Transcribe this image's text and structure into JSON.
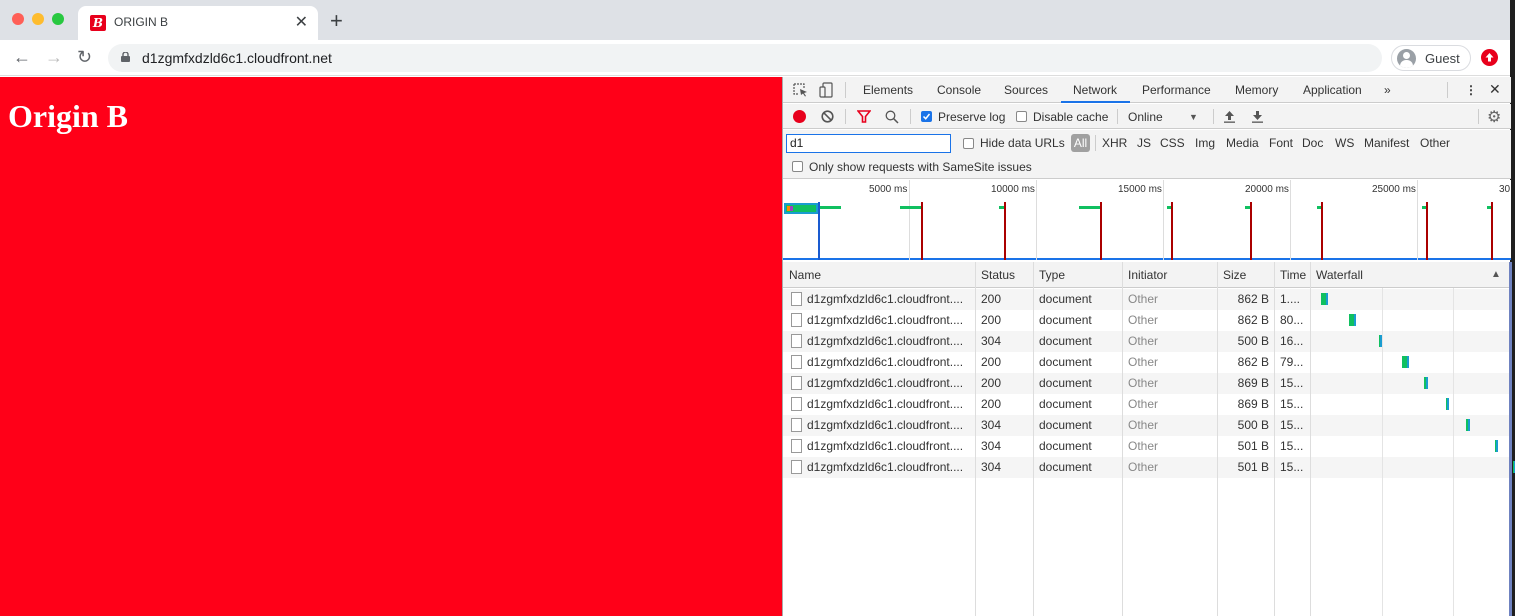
{
  "browser": {
    "tab": {
      "title": "ORIGIN B",
      "favicon_letter": "B"
    },
    "new_tab_label": "+",
    "url": "d1zgmfxdzld6c1.cloudfront.net",
    "profile_label": "Guest",
    "colors": {
      "brand_red": "#e8001c",
      "page_bg": "#ff0018"
    }
  },
  "page": {
    "heading": "Origin B"
  },
  "devtools": {
    "tabs": [
      "Elements",
      "Console",
      "Sources",
      "Network",
      "Performance",
      "Memory",
      "Application"
    ],
    "active_tab": "Network",
    "more_tabs_label": "»",
    "toolbar": {
      "preserve_log_label": "Preserve log",
      "preserve_log_checked": true,
      "disable_cache_label": "Disable cache",
      "disable_cache_checked": false,
      "throttling": "Online"
    },
    "filter": {
      "value": "d1",
      "hide_data_urls_label": "Hide data URLs",
      "types": [
        "All",
        "XHR",
        "JS",
        "CSS",
        "Img",
        "Media",
        "Font",
        "Doc",
        "WS",
        "Manifest",
        "Other"
      ],
      "active_type": "All",
      "samesite_label": "Only show requests with SameSite issues"
    },
    "overview": {
      "tick_labels": [
        "5000 ms",
        "10000 ms",
        "15000 ms",
        "20000 ms",
        "25000 ms",
        "30"
      ]
    },
    "table": {
      "columns": [
        "Name",
        "Status",
        "Type",
        "Initiator",
        "Size",
        "Time",
        "Waterfall"
      ],
      "sort_indicator": "▲",
      "rows": [
        {
          "name": "d1zgmfxdzld6c1.cloudfront....",
          "status": "200",
          "type": "document",
          "initiator": "Other",
          "size": "862 B",
          "time": "1...."
        },
        {
          "name": "d1zgmfxdzld6c1.cloudfront....",
          "status": "200",
          "type": "document",
          "initiator": "Other",
          "size": "862 B",
          "time": "80..."
        },
        {
          "name": "d1zgmfxdzld6c1.cloudfront....",
          "status": "304",
          "type": "document",
          "initiator": "Other",
          "size": "500 B",
          "time": "16..."
        },
        {
          "name": "d1zgmfxdzld6c1.cloudfront....",
          "status": "200",
          "type": "document",
          "initiator": "Other",
          "size": "862 B",
          "time": "79..."
        },
        {
          "name": "d1zgmfxdzld6c1.cloudfront....",
          "status": "200",
          "type": "document",
          "initiator": "Other",
          "size": "869 B",
          "time": "15..."
        },
        {
          "name": "d1zgmfxdzld6c1.cloudfront....",
          "status": "200",
          "type": "document",
          "initiator": "Other",
          "size": "869 B",
          "time": "15..."
        },
        {
          "name": "d1zgmfxdzld6c1.cloudfront....",
          "status": "304",
          "type": "document",
          "initiator": "Other",
          "size": "500 B",
          "time": "15..."
        },
        {
          "name": "d1zgmfxdzld6c1.cloudfront....",
          "status": "304",
          "type": "document",
          "initiator": "Other",
          "size": "501 B",
          "time": "15..."
        },
        {
          "name": "d1zgmfxdzld6c1.cloudfront....",
          "status": "304",
          "type": "document",
          "initiator": "Other",
          "size": "501 B",
          "time": "15..."
        }
      ]
    }
  }
}
